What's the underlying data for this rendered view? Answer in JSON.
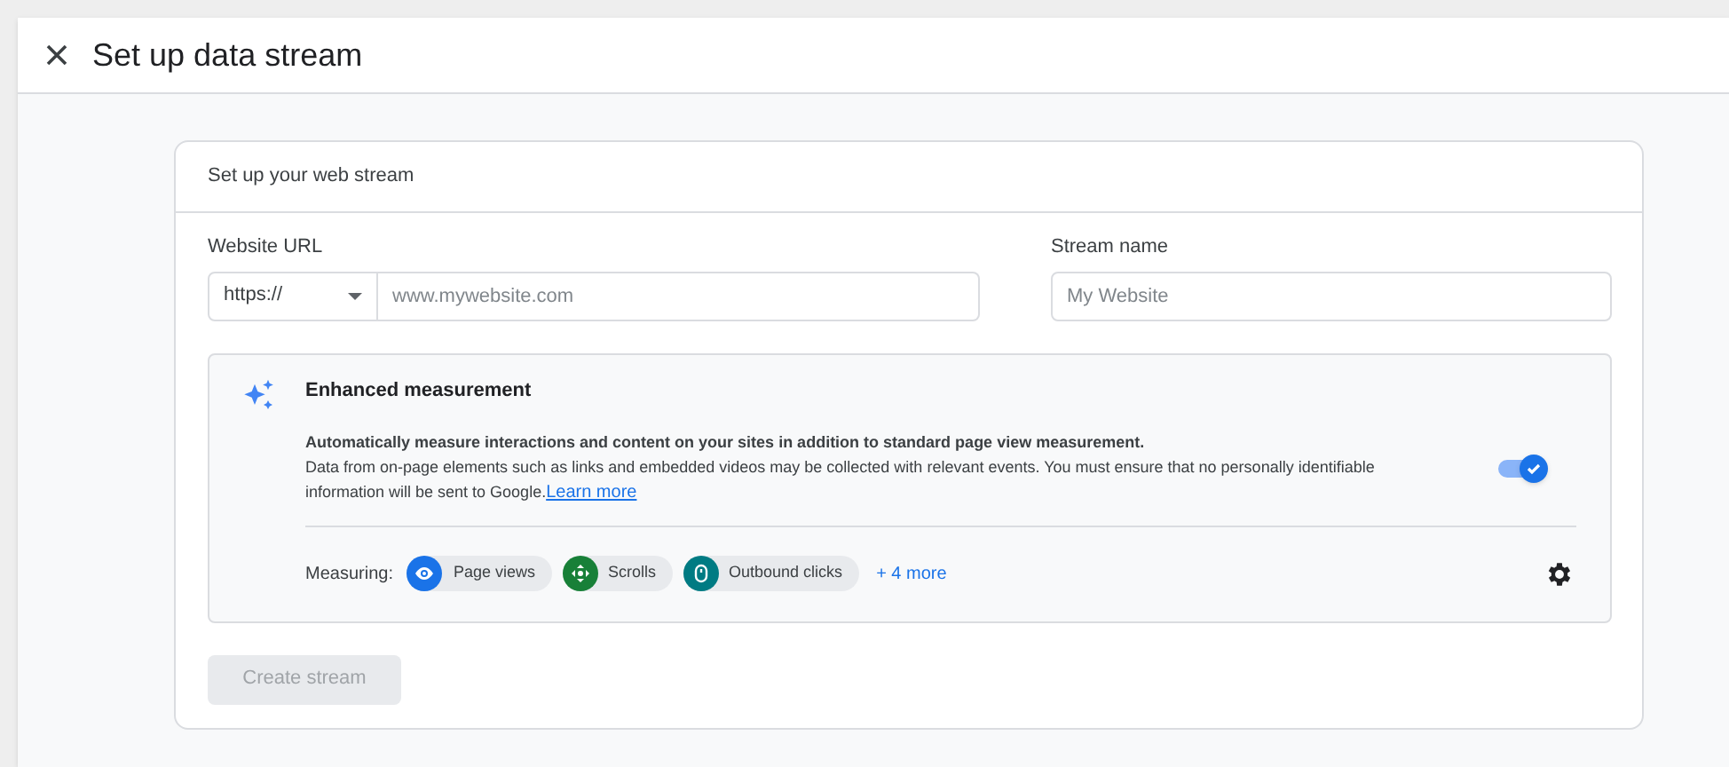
{
  "dialog": {
    "title": "Set up data stream"
  },
  "card": {
    "title": "Set up your web stream",
    "website_url": {
      "label": "Website URL",
      "protocol": "https://",
      "placeholder": "www.mywebsite.com"
    },
    "stream_name": {
      "label": "Stream name",
      "placeholder": "My Website"
    },
    "enhanced_measurement": {
      "title": "Enhanced measurement",
      "description_bold": "Automatically measure interactions and content on your sites in addition to standard page view measurement.",
      "description": "Data from on-page elements such as links and embedded videos may be collected with relevant events. You must ensure that no personally identifiable information will be sent to Google.",
      "link": "Learn more",
      "on": true,
      "measuring_label": "Measuring:",
      "chips": [
        {
          "kind": "eye",
          "label": "Page views",
          "color": "#1a73e8"
        },
        {
          "kind": "scroll",
          "label": "Scrolls",
          "color": "#188038"
        },
        {
          "kind": "mouse",
          "label": "Outbound clicks",
          "color": "#007b83"
        }
      ],
      "more": "+ 4 more"
    },
    "create_button": {
      "label": "Create stream",
      "disabled": true
    }
  }
}
